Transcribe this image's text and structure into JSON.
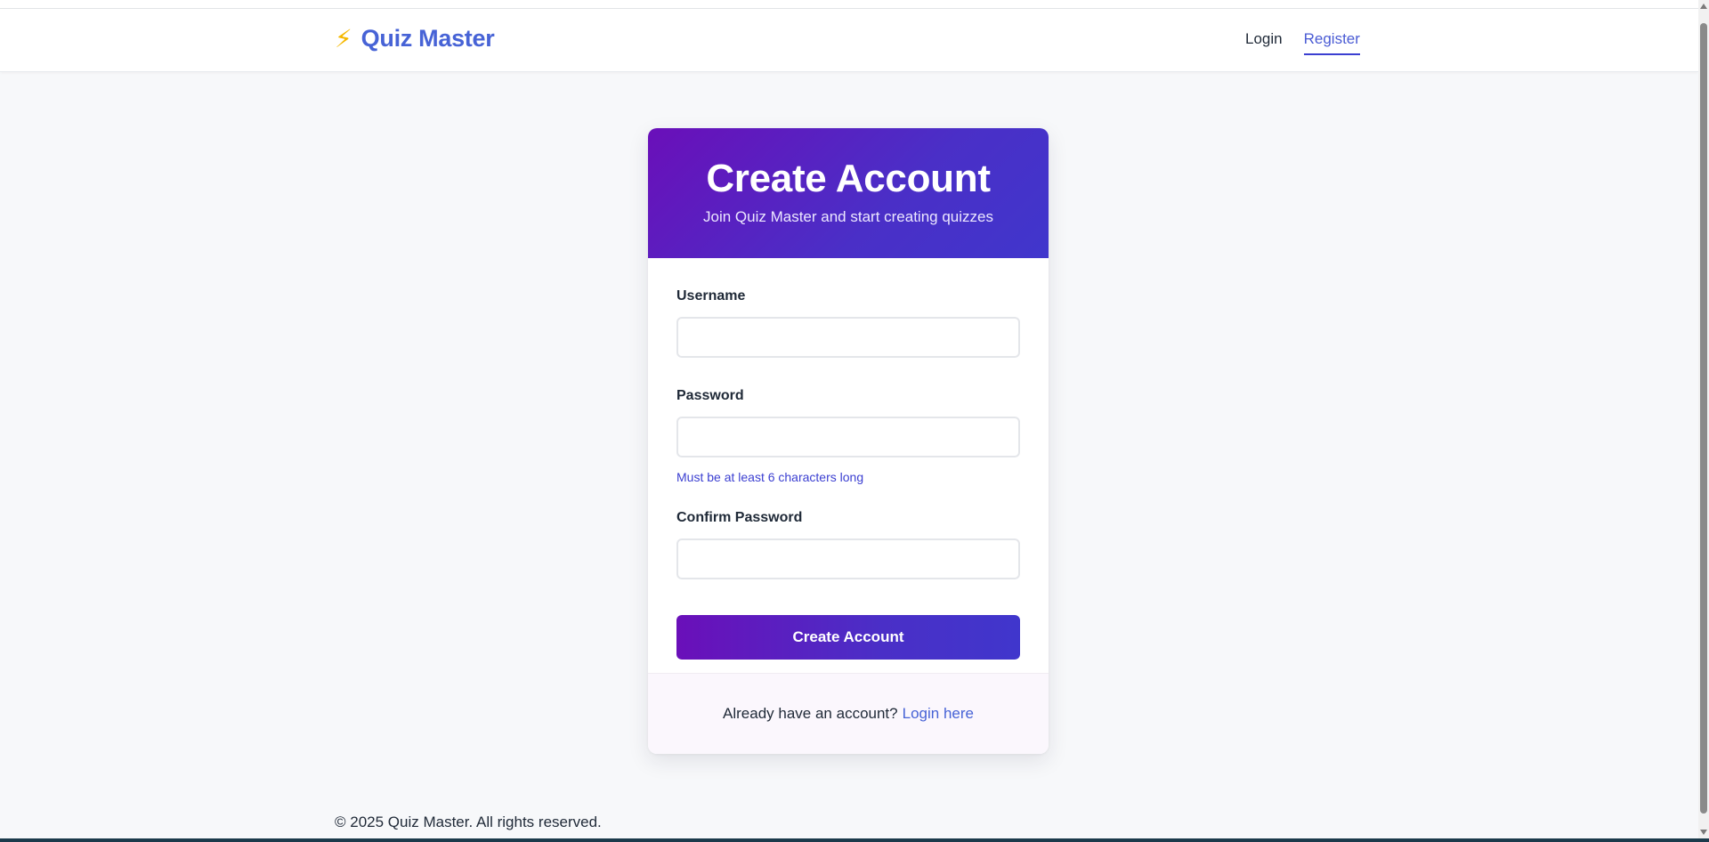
{
  "navbar": {
    "brand_icon": "⚡",
    "brand_name": "Quiz Master",
    "links": [
      {
        "label": "Login",
        "active": false
      },
      {
        "label": "Register",
        "active": true
      }
    ]
  },
  "card": {
    "title": "Create Account",
    "subtitle": "Join Quiz Master and start creating quizzes",
    "fields": {
      "username": {
        "label": "Username",
        "value": ""
      },
      "password": {
        "label": "Password",
        "value": "",
        "hint": "Must be at least 6 characters long"
      },
      "confirm_password": {
        "label": "Confirm Password",
        "value": ""
      }
    },
    "submit_label": "Create Account",
    "footer": {
      "prompt": "Already have an account?",
      "link_label": "Login here"
    }
  },
  "footer": {
    "copyright": "© 2025 Quiz Master. All rights reserved."
  },
  "colors": {
    "brand": "#4763d6",
    "accent": "#3b3fd1",
    "gradient_start": "#6a0fb9",
    "gradient_end": "#4036cc",
    "page_background": "#f7f8fa"
  }
}
